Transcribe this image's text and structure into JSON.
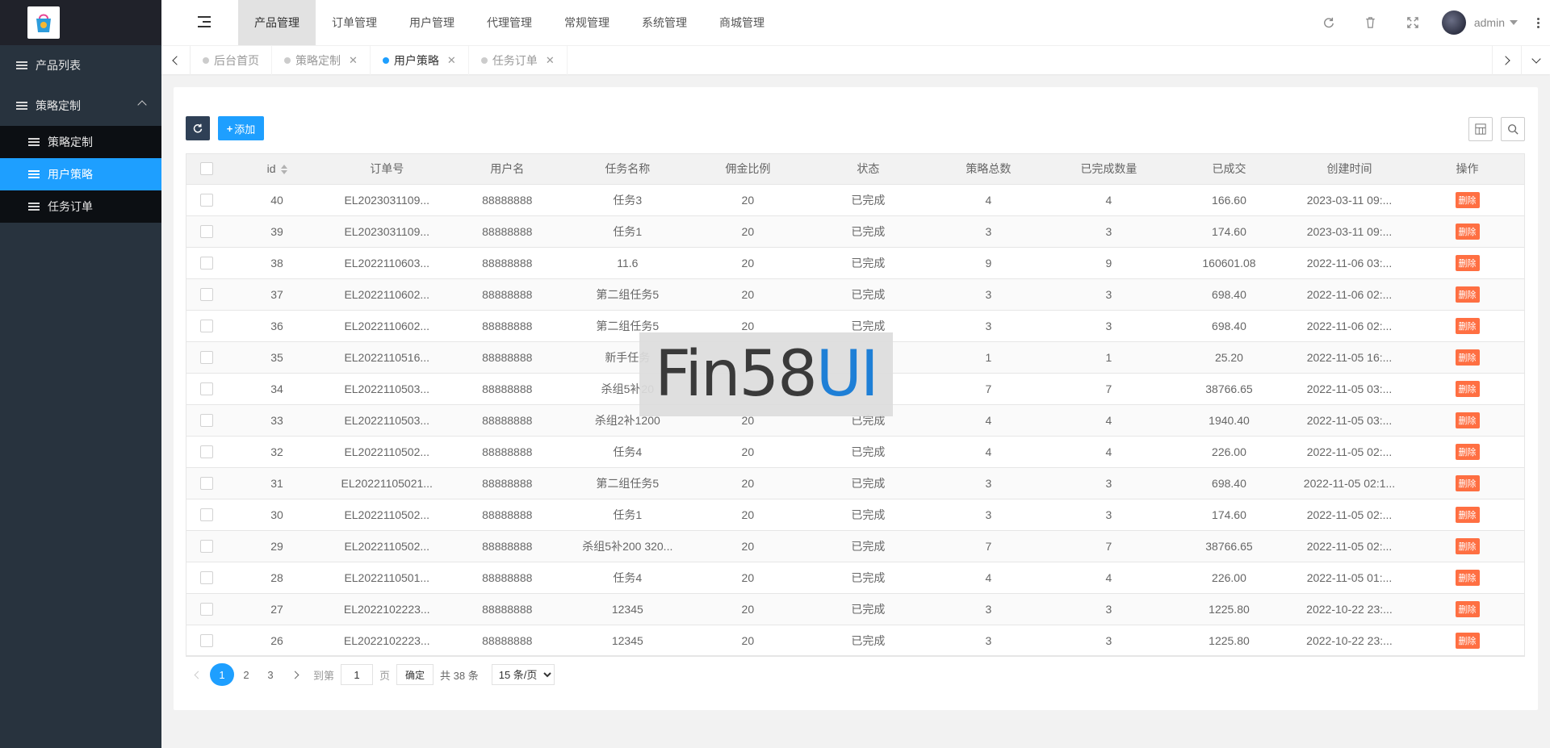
{
  "sidebar": {
    "items": [
      {
        "label": "产品列表"
      },
      {
        "label": "策略定制"
      }
    ],
    "submenu": [
      {
        "label": "策略定制"
      },
      {
        "label": "用户策略"
      },
      {
        "label": "任务订单"
      }
    ]
  },
  "header": {
    "nav": [
      "产品管理",
      "订单管理",
      "用户管理",
      "代理管理",
      "常规管理",
      "系统管理",
      "商城管理"
    ],
    "username": "admin"
  },
  "tabs": [
    {
      "label": "后台首页"
    },
    {
      "label": "策略定制"
    },
    {
      "label": "用户策略"
    },
    {
      "label": "任务订单"
    }
  ],
  "toolbar": {
    "add_label": "添加"
  },
  "table": {
    "columns": [
      "id",
      "订单号",
      "用户名",
      "任务名称",
      "佣金比例",
      "状态",
      "策略总数",
      "已完成数量",
      "已成交",
      "创建时间",
      "操作"
    ],
    "delete_label": "删除",
    "rows": [
      [
        "40",
        "EL2023031109...",
        "88888888",
        "任务3",
        "20",
        "已完成",
        "4",
        "4",
        "166.60",
        "2023-03-11 09:..."
      ],
      [
        "39",
        "EL2023031109...",
        "88888888",
        "任务1",
        "20",
        "已完成",
        "3",
        "3",
        "174.60",
        "2023-03-11 09:..."
      ],
      [
        "38",
        "EL2022110603...",
        "88888888",
        "11.6",
        "20",
        "已完成",
        "9",
        "9",
        "160601.08",
        "2022-11-06 03:..."
      ],
      [
        "37",
        "EL2022110602...",
        "88888888",
        "第二组任务5",
        "20",
        "已完成",
        "3",
        "3",
        "698.40",
        "2022-11-06 02:..."
      ],
      [
        "36",
        "EL2022110602...",
        "88888888",
        "第二组任务5",
        "20",
        "已完成",
        "3",
        "3",
        "698.40",
        "2022-11-06 02:..."
      ],
      [
        "35",
        "EL2022110516...",
        "88888888",
        "新手任务",
        "",
        "",
        "1",
        "1",
        "25.20",
        "2022-11-05 16:..."
      ],
      [
        "34",
        "EL2022110503...",
        "88888888",
        "杀组5补20",
        "",
        "",
        "7",
        "7",
        "38766.65",
        "2022-11-05 03:..."
      ],
      [
        "33",
        "EL2022110503...",
        "88888888",
        "杀组2补1200",
        "20",
        "已完成",
        "4",
        "4",
        "1940.40",
        "2022-11-05 03:..."
      ],
      [
        "32",
        "EL2022110502...",
        "88888888",
        "任务4",
        "20",
        "已完成",
        "4",
        "4",
        "226.00",
        "2022-11-05 02:..."
      ],
      [
        "31",
        "EL20221105021...",
        "88888888",
        "第二组任务5",
        "20",
        "已完成",
        "3",
        "3",
        "698.40",
        "2022-11-05 02:1..."
      ],
      [
        "30",
        "EL2022110502...",
        "88888888",
        "任务1",
        "20",
        "已完成",
        "3",
        "3",
        "174.60",
        "2022-11-05 02:..."
      ],
      [
        "29",
        "EL2022110502...",
        "88888888",
        "杀组5补200 320...",
        "20",
        "已完成",
        "7",
        "7",
        "38766.65",
        "2022-11-05 02:..."
      ],
      [
        "28",
        "EL2022110501...",
        "88888888",
        "任务4",
        "20",
        "已完成",
        "4",
        "4",
        "226.00",
        "2022-11-05 01:..."
      ],
      [
        "27",
        "EL2022102223...",
        "88888888",
        "12345",
        "20",
        "已完成",
        "3",
        "3",
        "1225.80",
        "2022-10-22 23:..."
      ],
      [
        "26",
        "EL2022102223...",
        "88888888",
        "12345",
        "20",
        "已完成",
        "3",
        "3",
        "1225.80",
        "2022-10-22 23:..."
      ]
    ]
  },
  "pagination": {
    "pages": [
      "1",
      "2",
      "3"
    ],
    "goto_label": "到第",
    "page_value": "1",
    "page_unit": "页",
    "confirm_label": "确定",
    "total_text": "共 38 条",
    "page_size": "15 条/页"
  },
  "watermark": {
    "part1": "Fin58",
    "part2": "UI"
  },
  "colors": {
    "sidebar": "#28333e",
    "accent": "#1e9fff",
    "danger": "#ff5722"
  }
}
